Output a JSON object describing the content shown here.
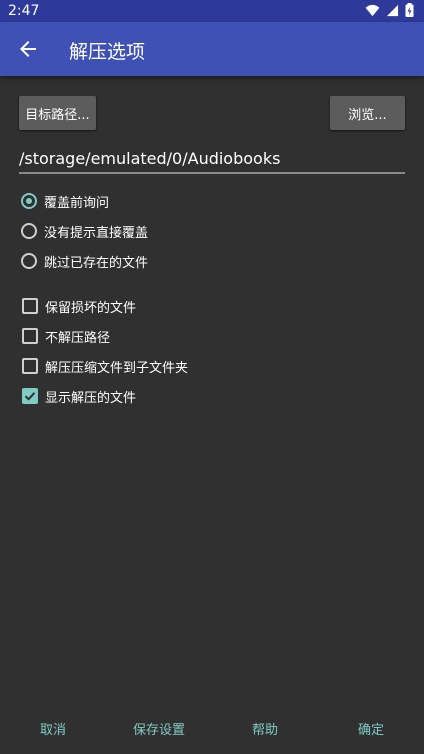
{
  "status_bar": {
    "time": "2:47",
    "icons": [
      "wifi-icon",
      "signal-icon",
      "battery-icon"
    ]
  },
  "app_bar": {
    "title": "解压选项",
    "back_icon": "arrow-left-icon"
  },
  "target": {
    "path_button_label": "目标路径...",
    "browse_button_label": "浏览...",
    "path_value": "/storage/emulated/0/Audiobooks"
  },
  "overwrite_options": [
    {
      "label": "覆盖前询问",
      "selected": true
    },
    {
      "label": "没有提示直接覆盖",
      "selected": false
    },
    {
      "label": "跳过已存在的文件",
      "selected": false
    }
  ],
  "checkbox_options": [
    {
      "label": "保留损坏的文件",
      "checked": false
    },
    {
      "label": "不解压路径",
      "checked": false
    },
    {
      "label": "解压压缩文件到子文件夹",
      "checked": false
    },
    {
      "label": "显示解压的文件",
      "checked": true
    }
  ],
  "footer": {
    "cancel_label": "取消",
    "save_settings_label": "保存设置",
    "help_label": "帮助",
    "ok_label": "确定"
  },
  "colors": {
    "status_bar": "#2e3a99",
    "app_bar": "#3f51b5",
    "background": "#303030",
    "accent": "#80cbc4",
    "button": "#5c5c5c"
  }
}
